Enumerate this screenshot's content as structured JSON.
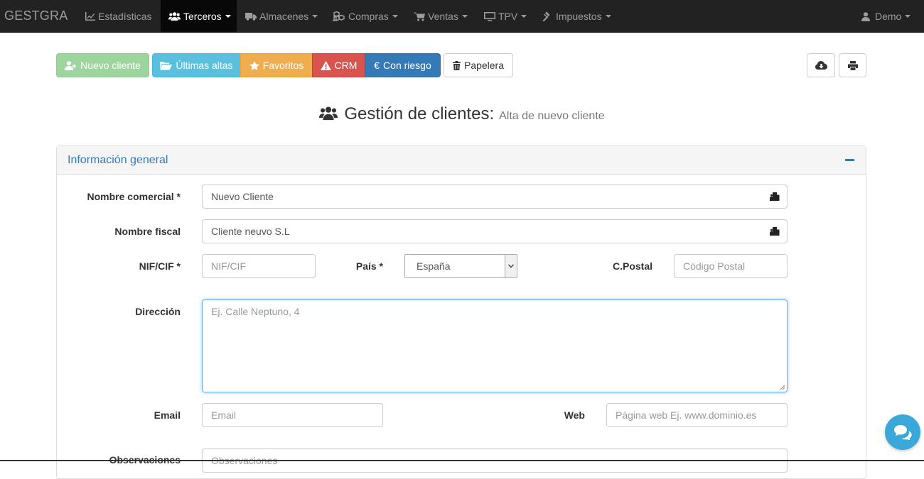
{
  "navbar": {
    "brand": "GESTGRA",
    "items": [
      {
        "label": "Estadísticas",
        "icon": "line-chart-icon"
      },
      {
        "label": "Terceros",
        "icon": "users-icon",
        "active": true
      },
      {
        "label": "Almacenes",
        "icon": "truck-icon"
      },
      {
        "label": "Compras",
        "icon": "cubes-icon"
      },
      {
        "label": "Ventas",
        "icon": "shopping-cart-icon"
      },
      {
        "label": "TPV",
        "icon": "desktop-icon"
      },
      {
        "label": "Impuestos",
        "icon": "gavel-icon"
      }
    ],
    "user": "Demo"
  },
  "toolbar": {
    "new_client": "Nuevo cliente",
    "latest": "Últimas altas",
    "favorites": "Favoritos",
    "crm": "CRM",
    "at_risk": "Con riesgo",
    "trash": "Papelera"
  },
  "page": {
    "title": "Gestión de clientes:",
    "subtitle": "Alta de nuevo cliente"
  },
  "panel": {
    "title": "Información general"
  },
  "form": {
    "commercial_name": {
      "label": "Nombre comercial *",
      "value": "Nuevo Cliente"
    },
    "fiscal_name": {
      "label": "Nombre fiscal",
      "value": "Cliente neuvo S.L"
    },
    "nif": {
      "label": "NIF/CIF *",
      "placeholder": "NIF/CIF"
    },
    "country": {
      "label": "País *",
      "value": "España"
    },
    "postal": {
      "label": "C.Postal",
      "placeholder": "Código Postal"
    },
    "address": {
      "label": "Dirección",
      "placeholder": "Ej. Calle Neptuno, 4"
    },
    "email": {
      "label": "Email",
      "placeholder": "Email"
    },
    "web": {
      "label": "Web",
      "placeholder": "Página web Ej. www.dominio.es"
    },
    "notes": {
      "label": "Observaciones",
      "placeholder": "Observaciones"
    }
  },
  "colors": {
    "navbar": "#222222",
    "success": "#9ed59e",
    "info": "#5bc0de",
    "warning": "#f0ad4e",
    "danger": "#d9534f",
    "primary": "#337ab7",
    "chat": "#3aa8d8"
  }
}
